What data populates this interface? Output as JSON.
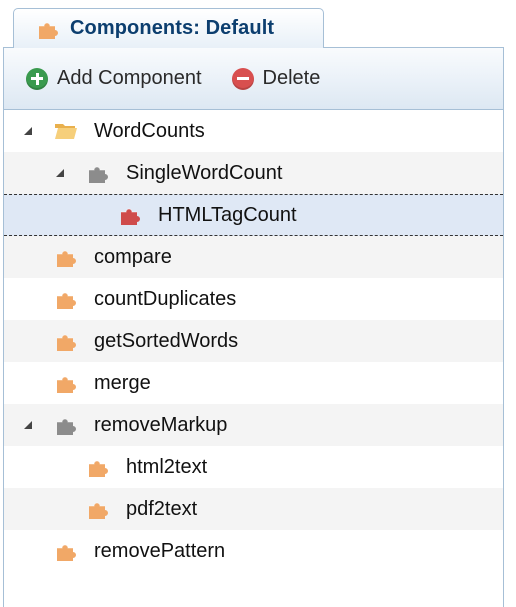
{
  "tab": {
    "title": "Components: Default",
    "icon": "puzzle-icon"
  },
  "toolbar": {
    "add_label": "Add Component",
    "delete_label": "Delete"
  },
  "colors": {
    "puzzle_orange": "#f1a867",
    "puzzle_gray": "#8c8c8c",
    "puzzle_red": "#cf4b4b",
    "folder": "#f3c76a",
    "selection": "#dfe8f5"
  },
  "tree": {
    "items": [
      {
        "label": "WordCounts",
        "level": 0,
        "expanded": true,
        "icon": "folder-icon"
      },
      {
        "label": "SingleWordCount",
        "level": 1,
        "expanded": true,
        "icon": "puzzle-gray-icon"
      },
      {
        "label": "HTMLTagCount",
        "level": 2,
        "selected": true,
        "icon": "puzzle-red-icon"
      },
      {
        "label": "compare",
        "level": 0,
        "icon": "puzzle-orange-icon"
      },
      {
        "label": "countDuplicates",
        "level": 0,
        "icon": "puzzle-orange-icon"
      },
      {
        "label": "getSortedWords",
        "level": 0,
        "icon": "puzzle-orange-icon"
      },
      {
        "label": "merge",
        "level": 0,
        "icon": "puzzle-orange-icon"
      },
      {
        "label": "removeMarkup",
        "level": 0,
        "expanded": true,
        "icon": "puzzle-gray-icon"
      },
      {
        "label": "html2text",
        "level": 1,
        "icon": "puzzle-orange-icon"
      },
      {
        "label": "pdf2text",
        "level": 1,
        "icon": "puzzle-orange-icon"
      },
      {
        "label": "removePattern",
        "level": 0,
        "icon": "puzzle-orange-icon"
      }
    ]
  }
}
